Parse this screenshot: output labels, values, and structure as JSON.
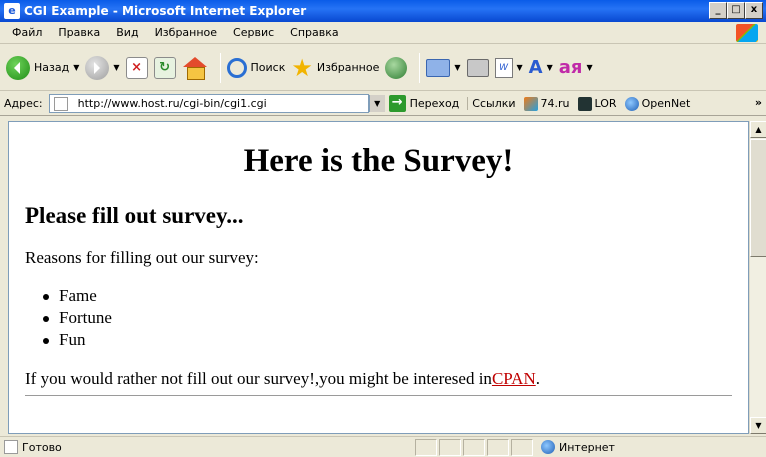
{
  "window": {
    "title": "CGI Example - Microsoft Internet Explorer",
    "controls": {
      "minimize": "_",
      "maximize": "□",
      "close": "x"
    }
  },
  "menu": {
    "items": [
      {
        "label": "Файл"
      },
      {
        "label": "Правка"
      },
      {
        "label": "Вид"
      },
      {
        "label": "Избранное"
      },
      {
        "label": "Сервис"
      },
      {
        "label": "Справка"
      }
    ]
  },
  "toolbar": {
    "back_label": "Назад",
    "search_label": "Поиск",
    "favorites_label": "Избранное"
  },
  "addressbar": {
    "label": "Адрес:",
    "url": "http://www.host.ru/cgi-bin/cgi1.cgi",
    "go_label": "Переход",
    "links_label": "Ссылки",
    "links": [
      {
        "label": "74.ru"
      },
      {
        "label": "LOR"
      },
      {
        "label": "OpenNet"
      }
    ],
    "more": "»"
  },
  "page": {
    "heading": "Here is the Survey!",
    "subheading": "Please fill out survey...",
    "reasons_text": "Reasons for filling out our survey:",
    "reasons": [
      "Fame",
      "Fortune",
      "Fun"
    ],
    "closing_text": "If you would rather not fill out our survey!,you might be interesed in",
    "link_text": "CPAN",
    "closing_end": "."
  },
  "status": {
    "text": "Готово",
    "zone": "Интернет"
  }
}
